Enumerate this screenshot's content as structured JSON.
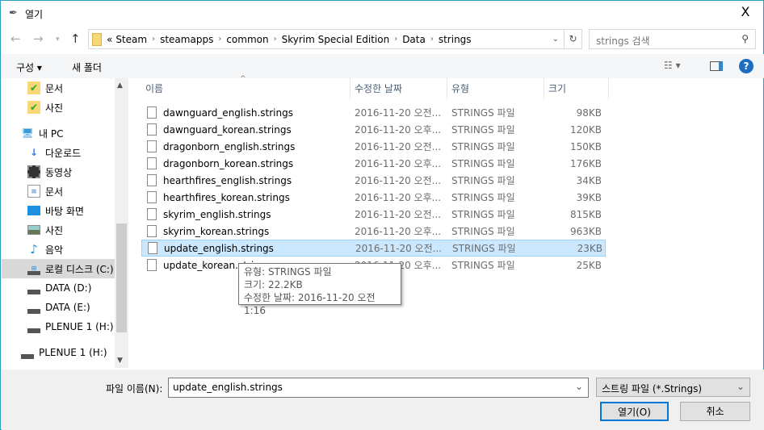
{
  "window": {
    "title": "열기",
    "close": "X"
  },
  "address": {
    "chevron": "«",
    "crumbs": [
      "Steam",
      "steamapps",
      "common",
      "Skyrim Special Edition",
      "Data",
      "strings"
    ],
    "search_placeholder": "strings 검색"
  },
  "toolbar": {
    "organize": "구성 ▾",
    "new_folder": "새 폴더"
  },
  "sidebar": {
    "items": [
      {
        "label": "문서",
        "icon": "folder-sync-icon"
      },
      {
        "label": "사진",
        "icon": "folder-sync-icon"
      },
      {
        "label": "내 PC",
        "icon": "pc-icon"
      },
      {
        "label": "다운로드",
        "icon": "download-icon"
      },
      {
        "label": "동영상",
        "icon": "video-icon"
      },
      {
        "label": "문서",
        "icon": "document-icon"
      },
      {
        "label": "바탕 화면",
        "icon": "desktop-icon"
      },
      {
        "label": "사진",
        "icon": "pictures-icon"
      },
      {
        "label": "음악",
        "icon": "music-icon"
      },
      {
        "label": "로컬 디스크 (C:)",
        "icon": "drive-icon"
      },
      {
        "label": "DATA (D:)",
        "icon": "drive-icon"
      },
      {
        "label": "DATA (E:)",
        "icon": "drive-icon"
      },
      {
        "label": "PLENUE 1 (H:)",
        "icon": "drive-icon"
      },
      {
        "label": "PLENUE 1 (H:)",
        "icon": "drive-icon"
      }
    ]
  },
  "columns": {
    "name": "이름",
    "date": "수정한 날짜",
    "type": "유형",
    "size": "크기"
  },
  "files": [
    {
      "name": "dawnguard_english.strings",
      "date": "2016-11-20 오전...",
      "type": "STRINGS 파일",
      "size": "98KB"
    },
    {
      "name": "dawnguard_korean.strings",
      "date": "2016-11-20 오후...",
      "type": "STRINGS 파일",
      "size": "120KB"
    },
    {
      "name": "dragonborn_english.strings",
      "date": "2016-11-20 오전...",
      "type": "STRINGS 파일",
      "size": "150KB"
    },
    {
      "name": "dragonborn_korean.strings",
      "date": "2016-11-20 오후...",
      "type": "STRINGS 파일",
      "size": "176KB"
    },
    {
      "name": "hearthfires_english.strings",
      "date": "2016-11-20 오전...",
      "type": "STRINGS 파일",
      "size": "34KB"
    },
    {
      "name": "hearthfires_korean.strings",
      "date": "2016-11-20 오후...",
      "type": "STRINGS 파일",
      "size": "39KB"
    },
    {
      "name": "skyrim_english.strings",
      "date": "2016-11-20 오전...",
      "type": "STRINGS 파일",
      "size": "815KB"
    },
    {
      "name": "skyrim_korean.strings",
      "date": "2016-11-20 오후...",
      "type": "STRINGS 파일",
      "size": "963KB"
    },
    {
      "name": "update_english.strings",
      "date": "2016-11-20 오전...",
      "type": "STRINGS 파일",
      "size": "23KB"
    },
    {
      "name": "update_korean.strings",
      "date": "2016-11-20 오후...",
      "type": "STRINGS 파일",
      "size": "25KB"
    }
  ],
  "tooltip": {
    "line1": "유형: STRINGS 파일",
    "line2": "크기: 22.2KB",
    "line3": "수정한 날짜: 2016-11-20 오전 1:16"
  },
  "footer": {
    "filename_label": "파일 이름(N):",
    "filename_value": "update_english.strings",
    "filter": "스트링 파일 (*.Strings)",
    "open": "열기(O)",
    "cancel": "취소"
  }
}
